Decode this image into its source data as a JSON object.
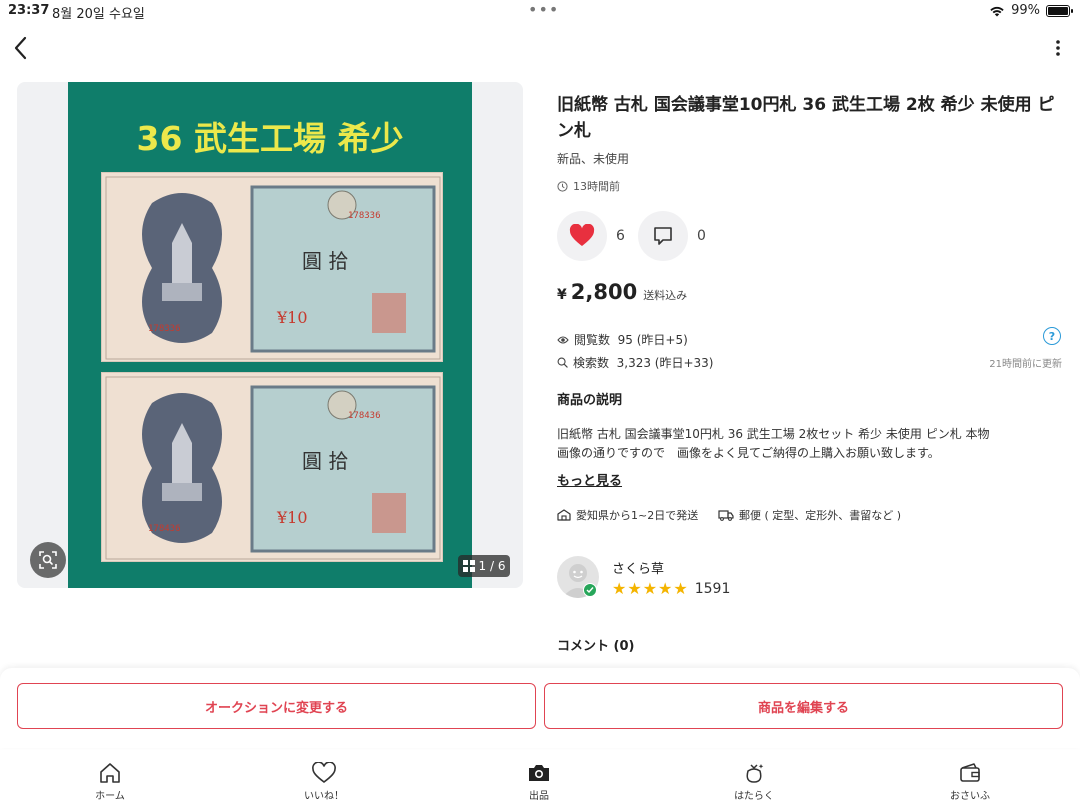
{
  "status_bar": {
    "time": "23:37",
    "date": "8월 20일 수요일",
    "battery": "99%",
    "battery_level": 0.99
  },
  "icons": {
    "back": "chevron-left-icon",
    "more": "more-vertical-icon",
    "scan": "image-search-icon",
    "gallery": "grid-icon",
    "like": "heart-icon",
    "comment": "comment-icon",
    "clock": "clock-icon",
    "eye": "eye-icon",
    "search": "search-icon",
    "help": "question-icon",
    "shipping_from": "box-icon",
    "shipping_method": "truck-icon",
    "home": "home-icon",
    "likes_tab": "heart-outline-icon",
    "sell": "camera-icon",
    "work": "bag-icon",
    "wallet": "wallet-icon"
  },
  "gallery": {
    "photo_title": "36 武生工場 希少",
    "counter": "1 / 6"
  },
  "product": {
    "title": "旧紙幣 古札 国会議事堂10円札 36 武生工場 2枚 希少 未使用 ピン札",
    "condition": "新品、未使用",
    "posted": "13時間前",
    "likes": "6",
    "comments": "0",
    "price_symbol": "¥",
    "price": "2,800",
    "shipping_included": "送料込み"
  },
  "stats": {
    "views": "閲覧数  95 (昨日+5)",
    "search": "検索数  3,323 (昨日+33)",
    "help": "?",
    "updated": "21時間前に更新"
  },
  "description": {
    "heading": "商品の説明",
    "lines": [
      "旧紙幣 古札 国会議事堂10円札 36 武生工場 2枚セット 希少 未使用 ピン札 本物",
      "画像の通りですので　画像をよく見てご納得の上購入お願い致します。"
    ],
    "more": "もっと見る"
  },
  "shipping": {
    "from": "愛知県から1~2日で発送",
    "method": "郵便 ( 定型、定形外、書留など )"
  },
  "seller": {
    "name": "さくら草",
    "stars": 5,
    "rating_count": "1591"
  },
  "comments_section": {
    "heading": "コメント (0)"
  },
  "actions": {
    "auction": "オークションに変更する",
    "edit": "商品を編集する"
  },
  "tabbar": {
    "home": "ホーム",
    "likes": "いいね！",
    "sell": "出品",
    "work": "はたらく",
    "wallet": "おさいふ"
  },
  "colors": {
    "accent": "#e04452",
    "heart": "#e8303f",
    "photo_bg": "#0f7d6a",
    "photo_title": "#ece84b",
    "star": "#f4b400",
    "help": "#2b9ad8",
    "verified": "#27a65a"
  }
}
